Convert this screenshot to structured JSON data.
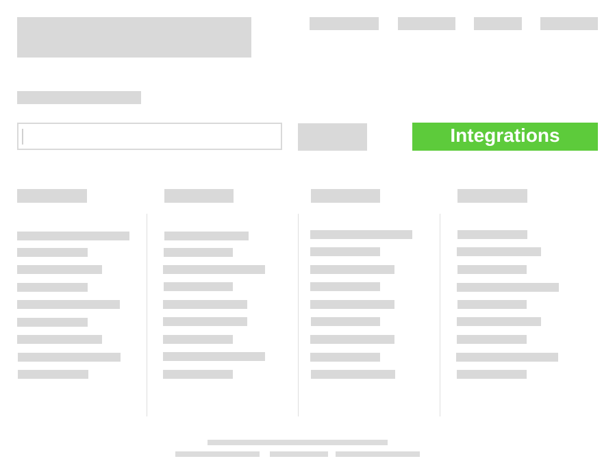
{
  "search": {
    "value": "",
    "placeholder": ""
  },
  "integrations_button": {
    "label": "Integrations",
    "color": "#5dcb3b"
  },
  "colors": {
    "placeholder_gray": "#d9d9d9",
    "background": "#ffffff"
  }
}
